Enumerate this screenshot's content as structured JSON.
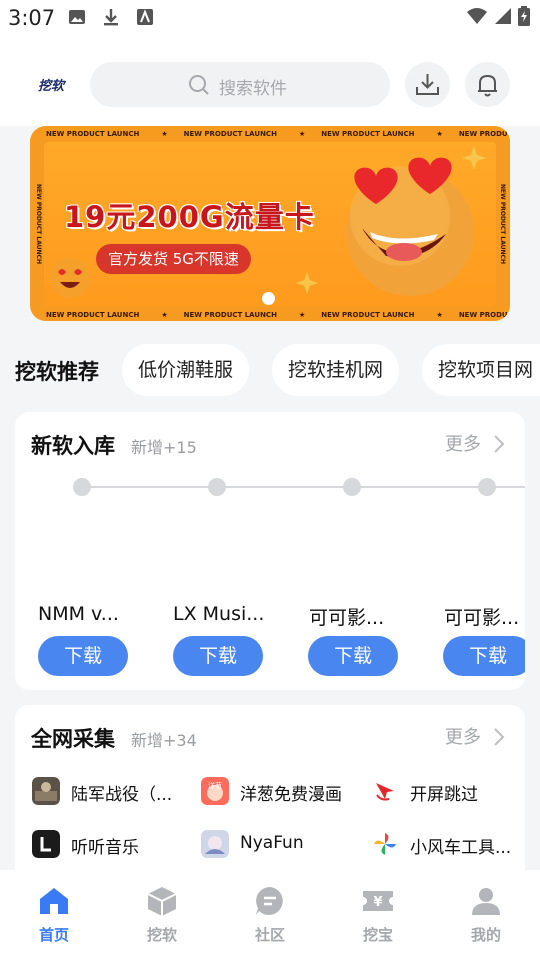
{
  "status": {
    "time": "3:07"
  },
  "header": {
    "logo_text": "挖软",
    "search_placeholder": "搜索软件"
  },
  "banner": {
    "ticker": "NEW PRODUCT LAUNCH",
    "headline": "19元200G流量卡",
    "pill": "官方发货 5G不限速"
  },
  "tabs": {
    "lead": "挖软推荐",
    "chips": [
      "低价潮鞋服",
      "挖软挂机网",
      "挖软项目网"
    ]
  },
  "new_apps": {
    "title": "新软入库",
    "subtitle": "新增+15",
    "more": "更多",
    "items": [
      {
        "name": "NMM v...",
        "button": "下载"
      },
      {
        "name": "LX Musi...",
        "button": "下载"
      },
      {
        "name": "可可影...",
        "button": "下载"
      },
      {
        "name": "可可影...",
        "button": "下载"
      }
    ]
  },
  "collection": {
    "title": "全网采集",
    "subtitle": "新增+34",
    "more": "更多",
    "items": [
      {
        "name": "陆军战役（...",
        "icon": "soldier-icon"
      },
      {
        "name": "洋葱免费漫画",
        "icon": "onion-icon"
      },
      {
        "name": "开屏跳过",
        "icon": "cursor-icon"
      },
      {
        "name": "听听音乐",
        "icon": "music-l-icon"
      },
      {
        "name": "NyaFun",
        "icon": "anime-icon"
      },
      {
        "name": "小风车工具...",
        "icon": "pinwheel-icon"
      }
    ]
  },
  "nav": {
    "items": [
      {
        "label": "首页",
        "active": true
      },
      {
        "label": "挖软",
        "active": false
      },
      {
        "label": "社区",
        "active": false
      },
      {
        "label": "挖宝",
        "active": false
      },
      {
        "label": "我的",
        "active": false
      }
    ]
  },
  "colors": {
    "accent": "#4a86f0",
    "nav_active": "#3a7bf5",
    "banner": "#f59a22"
  }
}
